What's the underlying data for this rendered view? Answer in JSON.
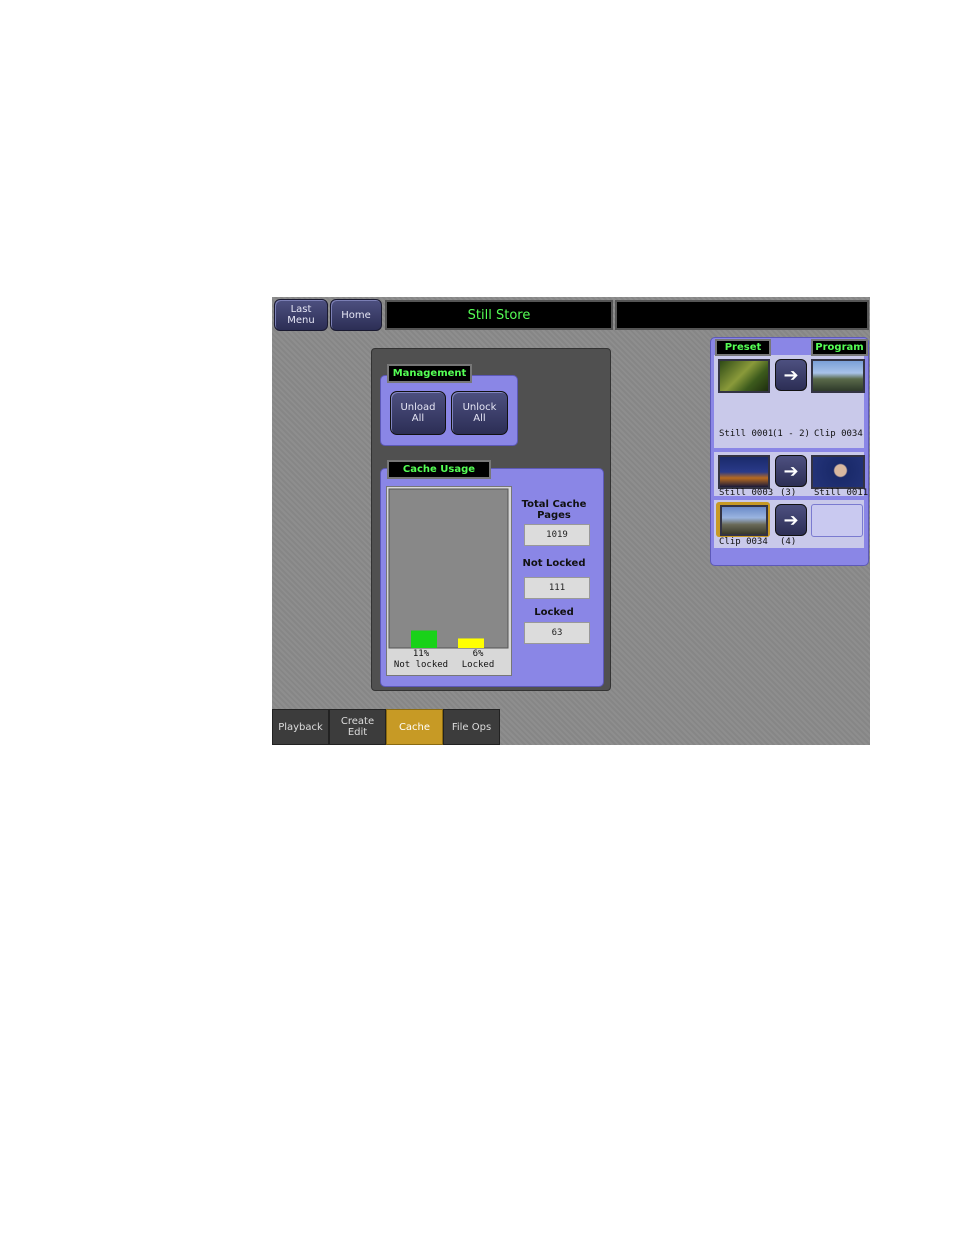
{
  "header": {
    "last_menu": "Last Menu",
    "home": "Home",
    "title": "Still Store",
    "status": ""
  },
  "management": {
    "tag": "Management",
    "unload_all": "Unload All",
    "unlock_all": "Unlock All"
  },
  "cache_usage": {
    "tag": "Cache Usage",
    "total_label": "Total Cache Pages",
    "total_value": "1019",
    "not_locked_label": "Not Locked",
    "not_locked_value": "111",
    "locked_label": "Locked",
    "locked_value": "63"
  },
  "chart_data": {
    "type": "bar",
    "categories": [
      "Not locked",
      "Locked"
    ],
    "values": [
      11,
      6
    ],
    "value_labels": [
      "11%",
      "6%"
    ],
    "ylim": [
      0,
      100
    ],
    "colors": [
      "#19d219",
      "#ffff00"
    ]
  },
  "preview": {
    "preset_tag": "Preset",
    "program_tag": "Program",
    "rows": [
      {
        "preset_label": "Still 0001",
        "middle": "(1 - 2)",
        "program_label": "Clip 0034"
      },
      {
        "preset_label": "Still 0003",
        "middle": "(3)",
        "program_label": "Still 0011"
      },
      {
        "preset_label": "Clip 0034",
        "middle": "(4)",
        "program_label": ""
      }
    ]
  },
  "tabs": [
    "Playback",
    "Create Edit",
    "Cache",
    "File Ops"
  ],
  "active_tab": "Cache",
  "colors": {
    "accent_green": "#55ff55",
    "violet": "#8a86e6",
    "active_tab": "#c79a25"
  }
}
